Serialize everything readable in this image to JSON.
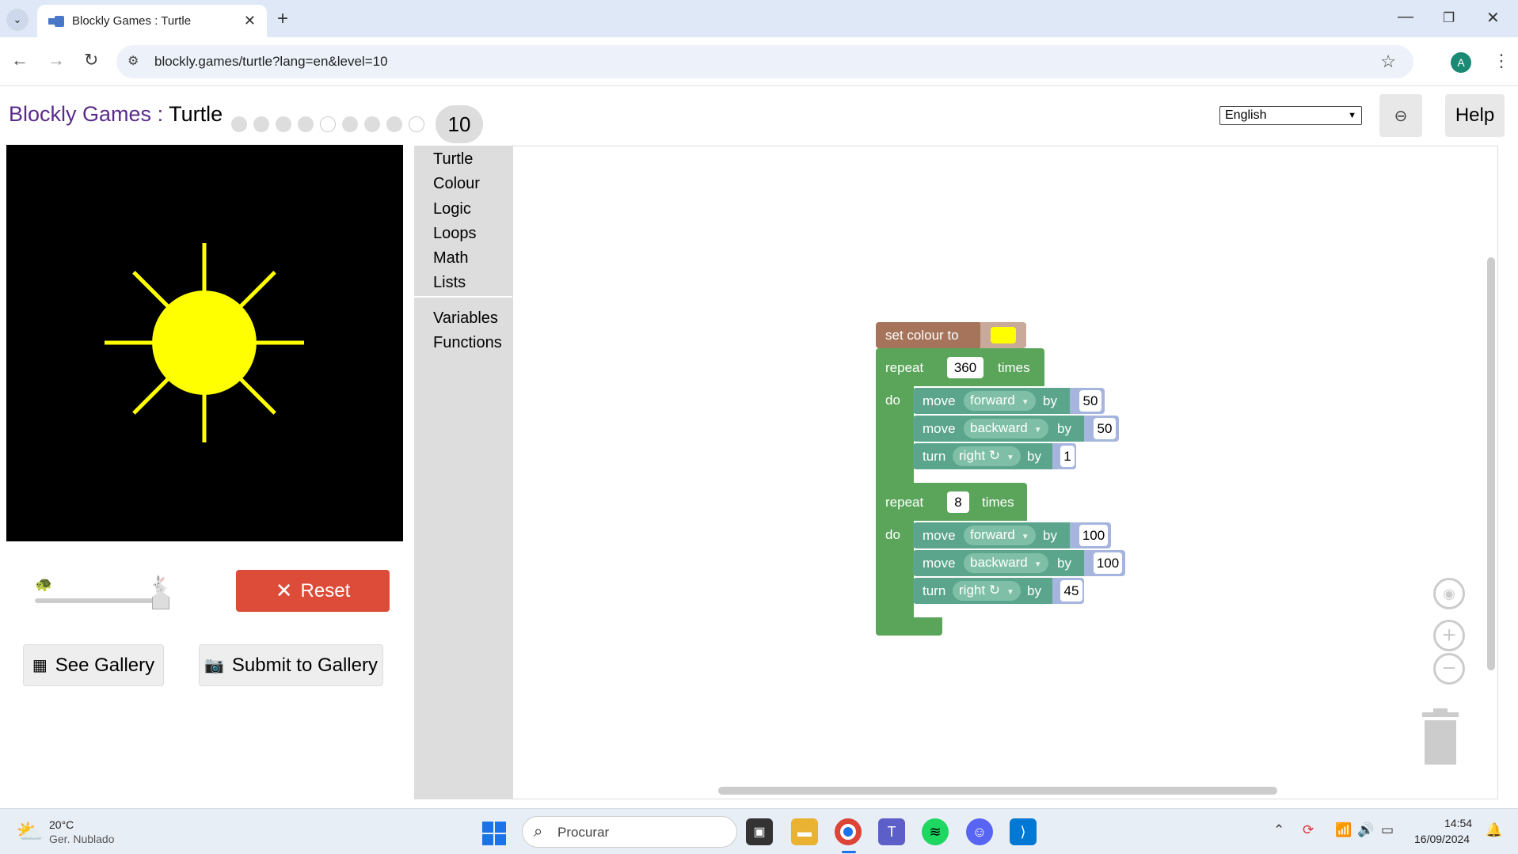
{
  "browser": {
    "tab_title": "Blockly Games : Turtle",
    "url": "blockly.games/turtle?lang=en&level=10",
    "avatar_letter": "A"
  },
  "header": {
    "brand": "Blockly Games",
    "separator": " : ",
    "page": "Turtle",
    "level_states": [
      "done",
      "done",
      "done",
      "done",
      "open",
      "done",
      "done",
      "done",
      "open"
    ],
    "current_level": "10",
    "language": "English",
    "help_label": "Help"
  },
  "controls": {
    "reset_label": "Reset",
    "see_gallery_label": "See Gallery",
    "submit_gallery_label": "Submit to Gallery",
    "speed_level": 1.0
  },
  "drawing": {
    "sun_color": "#ffff00",
    "background": "#000000",
    "rays": 8,
    "ray_length": 100,
    "circle_radius": 57.3
  },
  "toolbox": {
    "categories": [
      "Turtle",
      "Colour",
      "Logic",
      "Loops",
      "Math",
      "Lists"
    ],
    "categories2": [
      "Variables",
      "Functions"
    ]
  },
  "program": {
    "set_colour_label": "set colour to",
    "colour_value": "#ffff00",
    "loop1": {
      "repeat_label": "repeat",
      "count": "360",
      "times_label": "times",
      "do_label": "do",
      "steps": [
        {
          "verb": "move",
          "dir": "forward",
          "by": "by",
          "value": "50"
        },
        {
          "verb": "move",
          "dir": "backward",
          "by": "by",
          "value": "50"
        },
        {
          "verb": "turn",
          "dir": "right ↻",
          "by": "by",
          "value": "1"
        }
      ]
    },
    "loop2": {
      "repeat_label": "repeat",
      "count": "8",
      "times_label": "times",
      "do_label": "do",
      "steps": [
        {
          "verb": "move",
          "dir": "forward",
          "by": "by",
          "value": "100"
        },
        {
          "verb": "move",
          "dir": "backward",
          "by": "by",
          "value": "100"
        },
        {
          "verb": "turn",
          "dir": "right ↻",
          "by": "by",
          "value": "45"
        }
      ]
    }
  },
  "taskbar": {
    "temperature": "20°C",
    "weather": "Ger. Nublado",
    "search_placeholder": "Procurar",
    "time": "14:54",
    "date": "16/09/2024"
  },
  "colors": {
    "brand": "#5b2b8a",
    "reset": "#dd4b39",
    "loop_block": "#5ba55b",
    "turtle_block": "#5ba58c",
    "colour_block": "#a5745b"
  }
}
